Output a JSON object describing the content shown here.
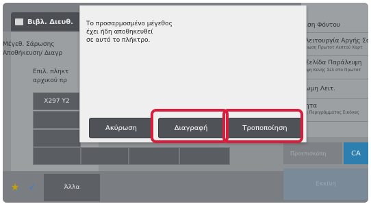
{
  "header": {
    "address_book": "Βιβλ. Διευθ."
  },
  "left_panel": {
    "scan_size": "Μέγεθ. Σάρωσης",
    "store": "Αποθήκευση/ Διαγρ",
    "prompt": "Επιλ. πληκτ\nαρχικού πρ",
    "size_button": "X297 Y2"
  },
  "bottom_bar": {
    "star_icon": "★",
    "check_icon": "✓",
    "other": "Άλλα"
  },
  "right_panel": {
    "items": [
      {
        "title": "ιση Φόντου",
        "sub": ""
      },
      {
        "title": "λειτουργία Αργής Σαρωσ",
        "sub": "ρωση Πρωτοτ Λεπτού Χαρτ"
      },
      {
        "title": "Σελίδα Παράλειψη",
        "sub": "ιψη Κενής Σελ στο Πρωτότ"
      },
      {
        "title": "ωμη Λειτ.",
        "sub": ""
      },
      {
        "title": "ητα",
        "sub": "η Περιγράμματος Εικόνας"
      }
    ],
    "preview": "Προεπισκόπη",
    "ca": "CA",
    "start": "Εκκίνη"
  },
  "modal": {
    "message": "Το προσαρμοσμένο μέγεθος\nέχει ήδη αποθηκευθεί\nσε αυτό το πλήκτρο.",
    "cancel": "Ακύρωση",
    "delete": "Διαγραφή",
    "modify": "Τροποποίηση"
  },
  "colors": {
    "highlight": "#d81e3c",
    "dialog_button": "#4f5358",
    "ca_button": "#2d7fb0"
  }
}
